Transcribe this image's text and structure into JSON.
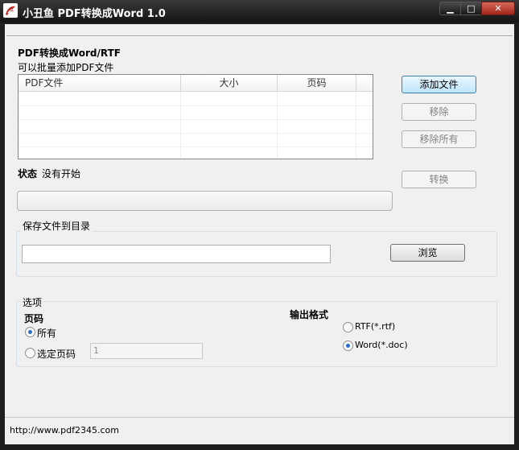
{
  "window": {
    "title": "小丑鱼 PDF转换成Word 1.0",
    "controls": {
      "minimize": "▁",
      "maximize": "□",
      "close": "✕"
    }
  },
  "section": {
    "heading": "PDF转换成Word/RTF",
    "subheading": "可以批量添加PDF文件"
  },
  "file_list": {
    "columns": [
      "PDF文件",
      "大小",
      "页码"
    ],
    "rows": []
  },
  "buttons": {
    "add_file": "添加文件",
    "remove": "移除",
    "remove_all": "移除所有",
    "convert": "转换",
    "browse": "浏览"
  },
  "status": {
    "label": "状态",
    "value": "没有开始",
    "progress": 0
  },
  "output_dir": {
    "group_title": "保存文件到目录",
    "value": ""
  },
  "options": {
    "group_title": "选项",
    "pages": {
      "label": "页码",
      "all": "所有",
      "selected": "选定页码",
      "page_input": "1",
      "choice": "all"
    },
    "format": {
      "label": "输出格式",
      "rtf": "RTF(*.rtf)",
      "word": "Word(*.doc)",
      "choice": "word"
    }
  },
  "footer": {
    "url": "http://www.pdf2345.com"
  },
  "colors": {
    "titlebar": "#1f1f1f",
    "client": "#f0f0f0",
    "accent": "#2a6ec6"
  }
}
